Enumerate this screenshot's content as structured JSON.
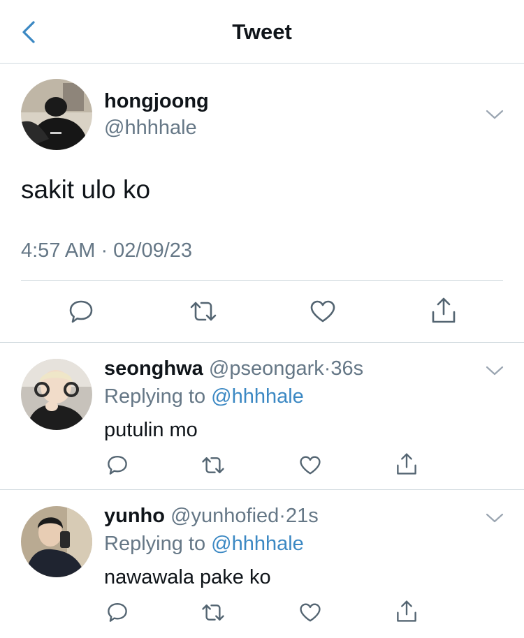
{
  "header": {
    "title": "Tweet",
    "back_icon": "chevron-left-icon"
  },
  "colors": {
    "link": "#3b88c3",
    "muted": "#657786",
    "divider": "#cfd9de",
    "text": "#0f1419"
  },
  "main_tweet": {
    "display_name": "hongjoong",
    "handle": "@hhhhale",
    "text": "sakit ulo ko",
    "timestamp": "4:57 AM · 02/09/23",
    "actions": [
      "reply-icon",
      "retweet-icon",
      "like-icon",
      "share-icon"
    ]
  },
  "replies": [
    {
      "display_name": "seonghwa",
      "handle": "@pseongark",
      "age": "36s",
      "replying_prefix": "Replying to ",
      "replying_to": "@hhhhale",
      "text": "putulin mo"
    },
    {
      "display_name": "yunho",
      "handle": "@yunhofied",
      "age": "21s",
      "replying_prefix": "Replying to ",
      "replying_to": "@hhhhale",
      "text": "nawawala pake ko"
    }
  ]
}
